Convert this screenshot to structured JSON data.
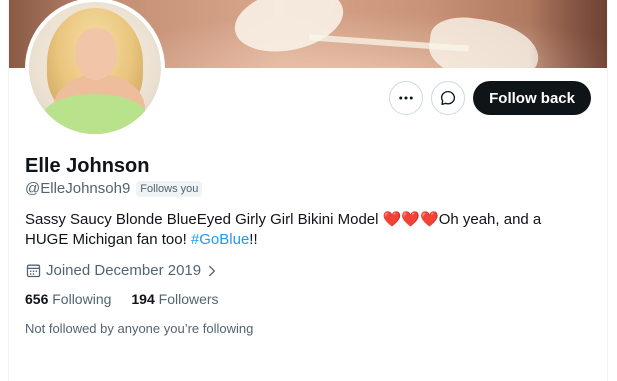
{
  "profile": {
    "name": "Elle Johnson",
    "handle": "@ElleJohnsoh9",
    "follows_you_badge": "Follows you",
    "bio_text": "Sassy Saucy Blonde BlueEyed Girly Girl Bikini Model ",
    "bio_hearts": "❤️❤️❤️",
    "bio_text_2": "Oh yeah, and a HUGE Michigan fan too! ",
    "bio_hashtag": "#GoBlue",
    "bio_end": "!!",
    "joined": "Joined December 2019",
    "following_count": "656",
    "following_label": "Following",
    "followers_count": "194",
    "followers_label": "Followers",
    "mutuals_text": "Not followed by anyone you’re following"
  },
  "actions": {
    "more_icon": "more-horizontal-icon",
    "message_icon": "message-icon",
    "follow_back_label": "Follow back"
  },
  "colors": {
    "accent": "#1d9bf0",
    "primary_text": "#0f1419",
    "secondary_text": "#536471",
    "button_dark": "#0f1419"
  }
}
